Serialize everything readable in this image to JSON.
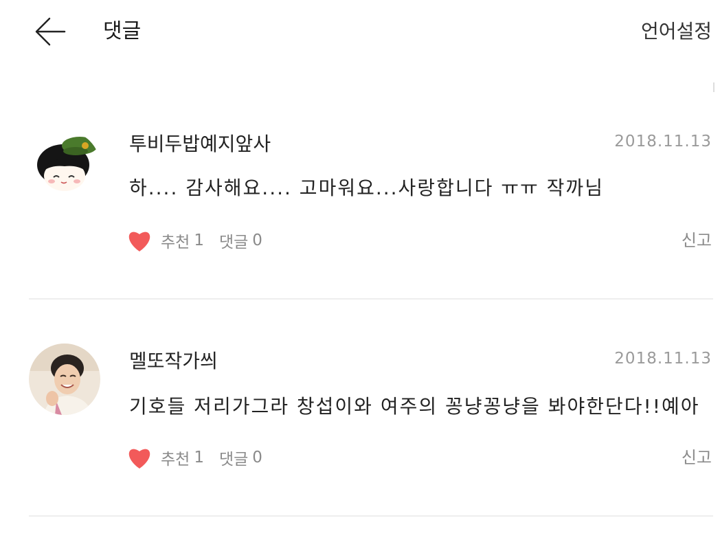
{
  "header": {
    "title": "댓글",
    "language_settings": "언어설정",
    "back_icon": "arrow-left-icon"
  },
  "comments": [
    {
      "author": "투비두밥예지앞사",
      "date": "2018.11.13",
      "text": "하.... 감사해요.... 고마워요...사랑합니다 ㅠㅠ 작까님",
      "like_label": "추천",
      "like_count": "1",
      "reply_label": "댓글",
      "reply_count": "0",
      "report_label": "신고",
      "avatar_icon": "cartoon-avatar-icon"
    },
    {
      "author": "멜또작가씌",
      "date": "2018.11.13",
      "text": "기호들 저리가그라 창섭이와 여주의 꽁냥꽁냥을 봐야한단다!!예아",
      "like_label": "추천",
      "like_count": "1",
      "reply_label": "댓글",
      "reply_count": "0",
      "report_label": "신고",
      "avatar_icon": "photo-avatar-icon"
    }
  ],
  "colors": {
    "heart": "#f25a5a",
    "meta_text": "#8a8a8a",
    "date_text": "#9a9a9a",
    "divider": "#eeeeee"
  }
}
